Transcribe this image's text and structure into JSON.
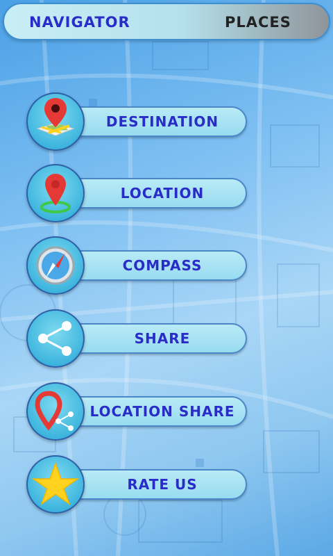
{
  "tabs": {
    "navigator": "NAVIGATOR",
    "places": "PLACES"
  },
  "menu": [
    {
      "label": "DESTINATION",
      "icon": "map-destination-icon"
    },
    {
      "label": "LOCATION",
      "icon": "location-pin-icon"
    },
    {
      "label": "COMPASS",
      "icon": "compass-icon"
    },
    {
      "label": "SHARE",
      "icon": "share-icon"
    },
    {
      "label": "LOCATION SHARE",
      "icon": "location-share-icon"
    },
    {
      "label": "RATE US",
      "icon": "star-icon"
    }
  ],
  "colors": {
    "label_text": "#2a2cc8",
    "pill_fill": "#a6e2f3",
    "icon_circle": "#3fb6de",
    "pin_red": "#e53935",
    "star_yellow": "#ffd21f"
  }
}
